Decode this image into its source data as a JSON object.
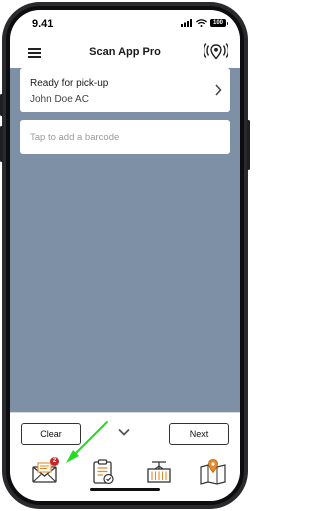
{
  "status_bar": {
    "time": "9.41",
    "battery": "100"
  },
  "app_bar": {
    "title": "Scan App Pro"
  },
  "order_card": {
    "title": "Ready for pick-up",
    "subtitle": "John Doe AC"
  },
  "barcode": {
    "placeholder": "Tap to add a barcode",
    "value": ""
  },
  "actions": {
    "clear_label": "Clear",
    "next_label": "Next"
  },
  "tabs": [
    {
      "icon": "envelope-icon",
      "badge": "2"
    },
    {
      "icon": "clipboard-check-icon"
    },
    {
      "icon": "container-crane-icon"
    },
    {
      "icon": "map-pin-icon"
    }
  ],
  "colors": {
    "background": "#7e90a6",
    "accent": "#e88a2a",
    "badge": "#c62828",
    "annotation_arrow": "#22dd22"
  }
}
